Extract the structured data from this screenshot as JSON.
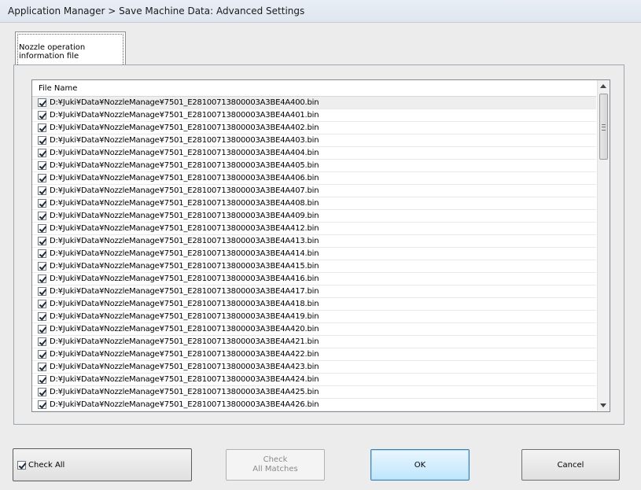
{
  "window": {
    "title": "Application Manager > Save Machine Data: Advanced Settings"
  },
  "tabs": [
    {
      "label": "Nozzle operation\ninformation file"
    }
  ],
  "list": {
    "header": "File Name",
    "rows": [
      {
        "checked": true,
        "name": "D:¥Juki¥Data¥NozzleManage¥7501_E28100713800003A3BE4A400.bin"
      },
      {
        "checked": true,
        "name": "D:¥Juki¥Data¥NozzleManage¥7501_E28100713800003A3BE4A401.bin"
      },
      {
        "checked": true,
        "name": "D:¥Juki¥Data¥NozzleManage¥7501_E28100713800003A3BE4A402.bin"
      },
      {
        "checked": true,
        "name": "D:¥Juki¥Data¥NozzleManage¥7501_E28100713800003A3BE4A403.bin"
      },
      {
        "checked": true,
        "name": "D:¥Juki¥Data¥NozzleManage¥7501_E28100713800003A3BE4A404.bin"
      },
      {
        "checked": true,
        "name": "D:¥Juki¥Data¥NozzleManage¥7501_E28100713800003A3BE4A405.bin"
      },
      {
        "checked": true,
        "name": "D:¥Juki¥Data¥NozzleManage¥7501_E28100713800003A3BE4A406.bin"
      },
      {
        "checked": true,
        "name": "D:¥Juki¥Data¥NozzleManage¥7501_E28100713800003A3BE4A407.bin"
      },
      {
        "checked": true,
        "name": "D:¥Juki¥Data¥NozzleManage¥7501_E28100713800003A3BE4A408.bin"
      },
      {
        "checked": true,
        "name": "D:¥Juki¥Data¥NozzleManage¥7501_E28100713800003A3BE4A409.bin"
      },
      {
        "checked": true,
        "name": "D:¥Juki¥Data¥NozzleManage¥7501_E28100713800003A3BE4A412.bin"
      },
      {
        "checked": true,
        "name": "D:¥Juki¥Data¥NozzleManage¥7501_E28100713800003A3BE4A413.bin"
      },
      {
        "checked": true,
        "name": "D:¥Juki¥Data¥NozzleManage¥7501_E28100713800003A3BE4A414.bin"
      },
      {
        "checked": true,
        "name": "D:¥Juki¥Data¥NozzleManage¥7501_E28100713800003A3BE4A415.bin"
      },
      {
        "checked": true,
        "name": "D:¥Juki¥Data¥NozzleManage¥7501_E28100713800003A3BE4A416.bin"
      },
      {
        "checked": true,
        "name": "D:¥Juki¥Data¥NozzleManage¥7501_E28100713800003A3BE4A417.bin"
      },
      {
        "checked": true,
        "name": "D:¥Juki¥Data¥NozzleManage¥7501_E28100713800003A3BE4A418.bin"
      },
      {
        "checked": true,
        "name": "D:¥Juki¥Data¥NozzleManage¥7501_E28100713800003A3BE4A419.bin"
      },
      {
        "checked": true,
        "name": "D:¥Juki¥Data¥NozzleManage¥7501_E28100713800003A3BE4A420.bin"
      },
      {
        "checked": true,
        "name": "D:¥Juki¥Data¥NozzleManage¥7501_E28100713800003A3BE4A421.bin"
      },
      {
        "checked": true,
        "name": "D:¥Juki¥Data¥NozzleManage¥7501_E28100713800003A3BE4A422.bin"
      },
      {
        "checked": true,
        "name": "D:¥Juki¥Data¥NozzleManage¥7501_E28100713800003A3BE4A423.bin"
      },
      {
        "checked": true,
        "name": "D:¥Juki¥Data¥NozzleManage¥7501_E28100713800003A3BE4A424.bin"
      },
      {
        "checked": true,
        "name": "D:¥Juki¥Data¥NozzleManage¥7501_E28100713800003A3BE4A425.bin"
      },
      {
        "checked": true,
        "name": "D:¥Juki¥Data¥NozzleManage¥7501_E28100713800003A3BE4A426.bin"
      }
    ]
  },
  "buttons": {
    "check_all": {
      "label": "Check All",
      "checked": true
    },
    "check_all_matches": {
      "label": "Check\nAll Matches",
      "enabled": false
    },
    "ok": {
      "label": "OK"
    },
    "cancel": {
      "label": "Cancel"
    }
  },
  "colors": {
    "ok_accent": "#3c7fb1",
    "disabled_text": "#8a8a8a"
  }
}
